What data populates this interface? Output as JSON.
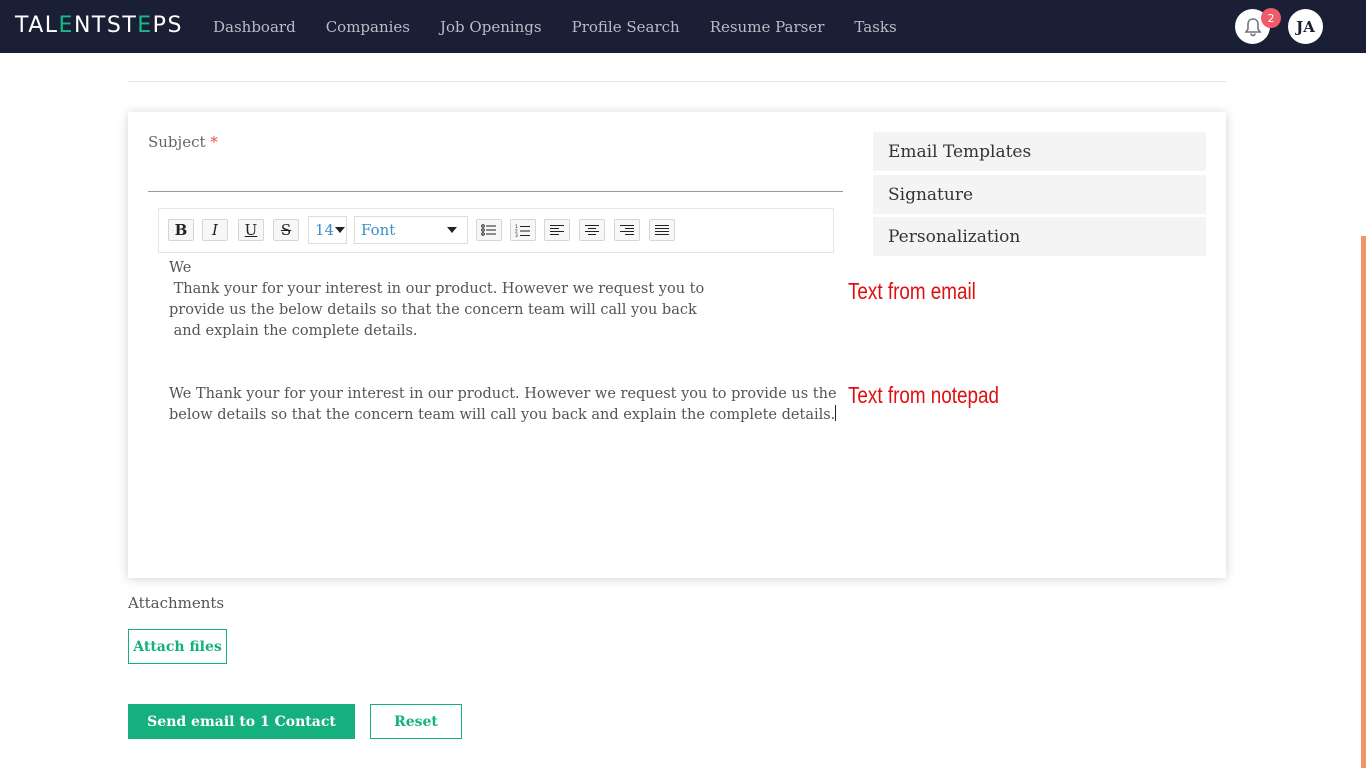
{
  "logo": {
    "part1": "TAL",
    "accent1": "E",
    "part2": "NTST",
    "accent2": "E",
    "part3": "PS"
  },
  "nav": [
    "Dashboard",
    "Companies",
    "Job Openings",
    "Profile Search",
    "Resume Parser",
    "Tasks"
  ],
  "notifications": {
    "count": "2",
    "icon": "bell-icon"
  },
  "user": {
    "initials": "JA"
  },
  "subject": {
    "label": "Subject",
    "required_mark": "*",
    "value": ""
  },
  "toolbar": {
    "bold": "B",
    "italic": "I",
    "underline": "U",
    "strike": "S",
    "font_size": "14",
    "font": "Font"
  },
  "editor": {
    "email_lines": [
      "We",
      " Thank your for your interest in our product. However we request you to",
      "provide us the below details so that the concern team will call you back",
      " and explain the complete details."
    ],
    "notepad_lines": [
      "We Thank your for your interest in our product. However we request you to provide us the",
      "below details so that the concern team will call you back and explain the complete details."
    ]
  },
  "side_panel": [
    "Email Templates",
    "Signature",
    "Personalization"
  ],
  "annotations": {
    "email": "Text from email",
    "notepad": "Text from notepad"
  },
  "attachments": {
    "label": "Attachments",
    "button": "Attach files"
  },
  "actions": {
    "send": "Send email to 1 Contact",
    "reset": "Reset"
  },
  "colors": {
    "topbar": "#1a1f35",
    "accent": "#14b07d",
    "annotation": "#e01010",
    "badge": "#f05a6a"
  }
}
